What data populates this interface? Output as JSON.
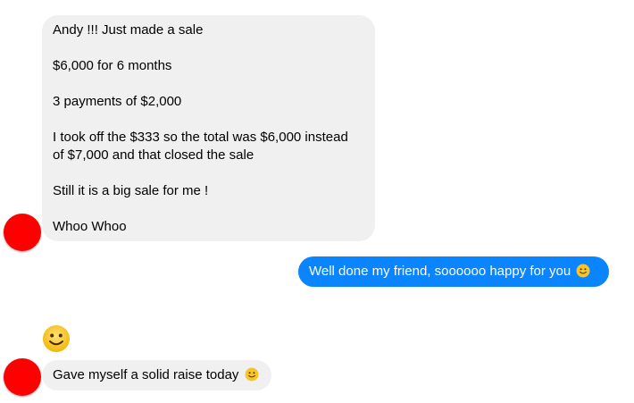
{
  "conversation": {
    "incoming_1": {
      "line_1": "Andy !!!   Just made a sale",
      "line_2": "$6,000 for 6 months",
      "line_3": "3 payments of $2,000",
      "line_4a": "I took off the $333 so the total was $6,000 instead",
      "line_4b": "of $7,000 and that closed the sale",
      "line_5": "Still it is a big sale for me !",
      "line_6": "Whoo Whoo"
    },
    "outgoing_1": {
      "text": "Well done my friend, soooooo happy for you",
      "emoji": "slightly-smiling-face-icon"
    },
    "standalone_emoji": "slightly-smiling-face-icon",
    "incoming_2": {
      "text": "Gave myself a solid raise today",
      "emoji": "slightly-smiling-face-icon"
    }
  },
  "colors": {
    "incoming_bubble": "#f0f0f0",
    "outgoing_bubble": "#0a84ff",
    "avatar": "#ff0000",
    "emoji_face": "#f7c42a"
  }
}
